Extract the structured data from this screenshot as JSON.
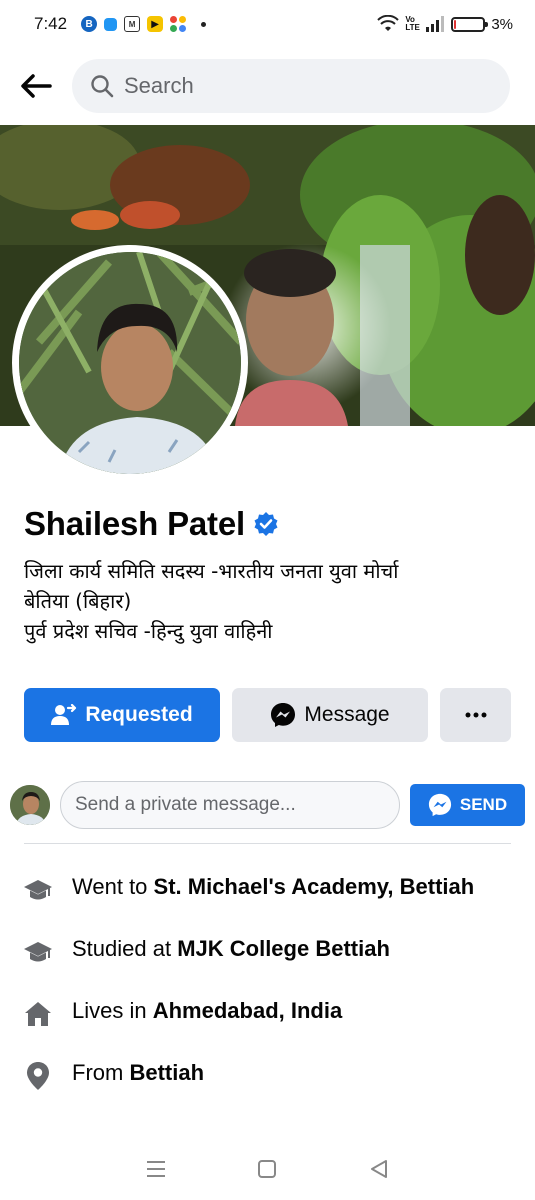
{
  "status_bar": {
    "time": "7:42",
    "battery_text": "3%",
    "battery_level": 0.03,
    "network_label": "Vo LTE"
  },
  "header": {
    "search_placeholder": "Search"
  },
  "profile": {
    "name": "Shailesh Patel",
    "verified": true,
    "bio_lines": [
      "जिला कार्य समिति सदस्य -भारतीय जनता युवा मोर्चा",
      "बेतिया (बिहार)",
      "पुर्व प्रदेश सचिव -हिन्दु युवा वाहिनी"
    ]
  },
  "actions": {
    "requested_label": "Requested",
    "message_label": "Message",
    "more_label": "···"
  },
  "message_box": {
    "placeholder": "Send a private message...",
    "send_label": "SEND"
  },
  "details": [
    {
      "icon": "graduation-cap-icon",
      "prefix": "Went to ",
      "value": "St. Michael's Academy, Bettiah"
    },
    {
      "icon": "graduation-cap-icon",
      "prefix": "Studied at ",
      "value": "MJK College Bettiah"
    },
    {
      "icon": "home-icon",
      "prefix": "Lives in ",
      "value": "Ahmedabad, India"
    },
    {
      "icon": "location-pin-icon",
      "prefix": "From ",
      "value": "Bettiah"
    }
  ],
  "colors": {
    "primary_blue": "#1b74e4",
    "secondary_gray": "#e4e6eb",
    "text": "#050505",
    "muted_text": "#65676b"
  }
}
